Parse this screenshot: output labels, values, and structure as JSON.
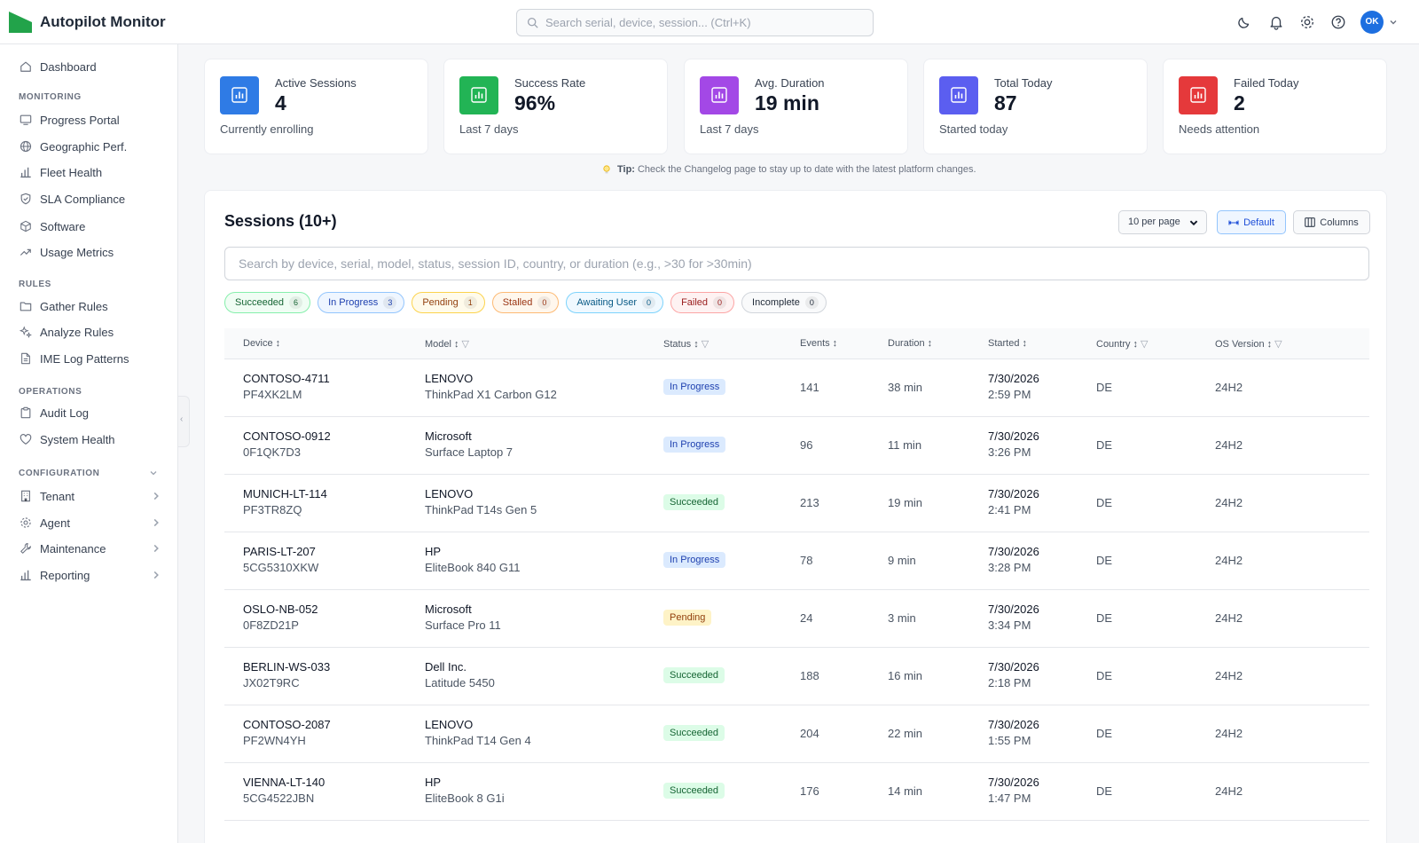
{
  "header": {
    "title": "Autopilot Monitor",
    "search_placeholder": "Search serial, device, session... (Ctrl+K)",
    "avatar_initials": "OK",
    "brand_color": "#22a34a"
  },
  "sidebar": {
    "dashboard": "Dashboard",
    "sections": {
      "monitoring": "MONITORING",
      "rules": "RULES",
      "operations": "OPERATIONS",
      "configuration": "CONFIGURATION"
    },
    "monitoring": [
      "Progress Portal",
      "Geographic Perf.",
      "Fleet Health",
      "SLA Compliance",
      "Software",
      "Usage Metrics"
    ],
    "rules": [
      "Gather Rules",
      "Analyze Rules",
      "IME Log Patterns"
    ],
    "operations": [
      "Audit Log",
      "System Health"
    ],
    "configuration": [
      "Tenant",
      "Agent",
      "Maintenance",
      "Reporting"
    ]
  },
  "kpis": [
    {
      "label": "Active Sessions",
      "value": "4",
      "sub": "Currently enrolling",
      "color": "#2f7be5"
    },
    {
      "label": "Success Rate",
      "value": "96%",
      "sub": "Last 7 days",
      "color": "#22b455"
    },
    {
      "label": "Avg. Duration",
      "value": "19 min",
      "sub": "Last 7 days",
      "color": "#a348e6"
    },
    {
      "label": "Total Today",
      "value": "87",
      "sub": "Started today",
      "color": "#5b5ef0"
    },
    {
      "label": "Failed Today",
      "value": "2",
      "sub": "Needs attention",
      "color": "#e5393b"
    }
  ],
  "tip": {
    "label": "Tip:",
    "text": "Check the Changelog page to stay up to date with the latest platform changes."
  },
  "sessions": {
    "title": "Sessions (10+)",
    "per_page": "10 per page",
    "default_label": "Default",
    "columns_label": "Columns",
    "search_placeholder": "Search by device, serial, model, status, session ID, country, or duration (e.g., >30 for >30min)",
    "chips": [
      {
        "label": "Succeeded",
        "count": "6"
      },
      {
        "label": "In Progress",
        "count": "3"
      },
      {
        "label": "Pending",
        "count": "1"
      },
      {
        "label": "Stalled",
        "count": "0"
      },
      {
        "label": "Awaiting User",
        "count": "0"
      },
      {
        "label": "Failed",
        "count": "0"
      },
      {
        "label": "Incomplete",
        "count": "0"
      }
    ],
    "columns": [
      "Device",
      "Model",
      "Status",
      "Events",
      "Duration",
      "Started",
      "Country",
      "OS Version"
    ],
    "rows": [
      {
        "device": "CONTOSO-4711",
        "serial": "PF4XK2LM",
        "vendor": "LENOVO",
        "model": "ThinkPad X1 Carbon G12",
        "status": "In Progress",
        "events": "141",
        "duration": "38 min",
        "date": "7/30/2026",
        "time": "2:59 PM",
        "country": "DE",
        "os": "24H2"
      },
      {
        "device": "CONTOSO-0912",
        "serial": "0F1QK7D3",
        "vendor": "Microsoft",
        "model": "Surface Laptop 7",
        "status": "In Progress",
        "events": "96",
        "duration": "11 min",
        "date": "7/30/2026",
        "time": "3:26 PM",
        "country": "DE",
        "os": "24H2"
      },
      {
        "device": "MUNICH-LT-114",
        "serial": "PF3TR8ZQ",
        "vendor": "LENOVO",
        "model": "ThinkPad T14s Gen 5",
        "status": "Succeeded",
        "events": "213",
        "duration": "19 min",
        "date": "7/30/2026",
        "time": "2:41 PM",
        "country": "DE",
        "os": "24H2"
      },
      {
        "device": "PARIS-LT-207",
        "serial": "5CG5310XKW",
        "vendor": "HP",
        "model": "EliteBook 840 G11",
        "status": "In Progress",
        "events": "78",
        "duration": "9 min",
        "date": "7/30/2026",
        "time": "3:28 PM",
        "country": "DE",
        "os": "24H2"
      },
      {
        "device": "OSLO-NB-052",
        "serial": "0F8ZD21P",
        "vendor": "Microsoft",
        "model": "Surface Pro 11",
        "status": "Pending",
        "events": "24",
        "duration": "3 min",
        "date": "7/30/2026",
        "time": "3:34 PM",
        "country": "DE",
        "os": "24H2"
      },
      {
        "device": "BERLIN-WS-033",
        "serial": "JX02T9RC",
        "vendor": "Dell Inc.",
        "model": "Latitude 5450",
        "status": "Succeeded",
        "events": "188",
        "duration": "16 min",
        "date": "7/30/2026",
        "time": "2:18 PM",
        "country": "DE",
        "os": "24H2"
      },
      {
        "device": "CONTOSO-2087",
        "serial": "PF2WN4YH",
        "vendor": "LENOVO",
        "model": "ThinkPad T14 Gen 4",
        "status": "Succeeded",
        "events": "204",
        "duration": "22 min",
        "date": "7/30/2026",
        "time": "1:55 PM",
        "country": "DE",
        "os": "24H2"
      },
      {
        "device": "VIENNA-LT-140",
        "serial": "5CG4522JBN",
        "vendor": "HP",
        "model": "EliteBook 8 G1i",
        "status": "Succeeded",
        "events": "176",
        "duration": "14 min",
        "date": "7/30/2026",
        "time": "1:47 PM",
        "country": "DE",
        "os": "24H2"
      }
    ]
  }
}
